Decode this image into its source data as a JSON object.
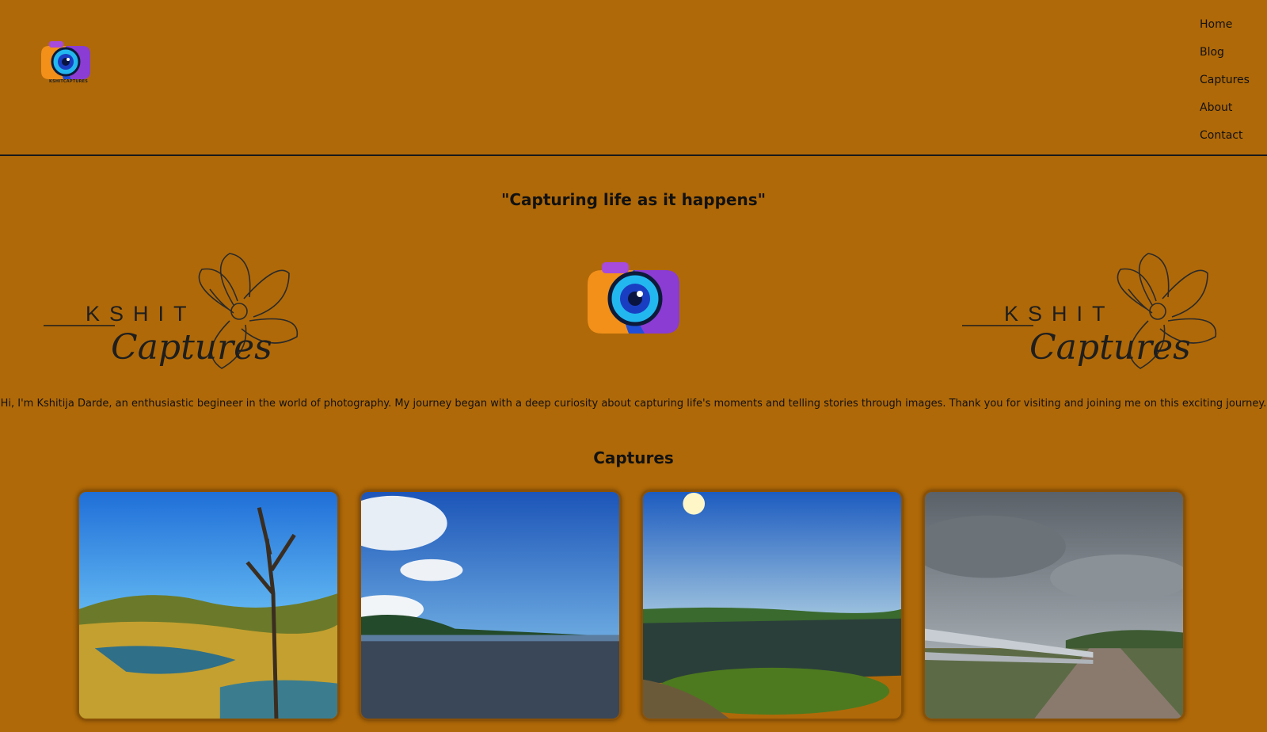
{
  "theme": {
    "background": "#b06908",
    "text": "#111111",
    "accent": "#1e1e1e"
  },
  "header": {
    "logo_text": "KSHITCAPTURES",
    "logo_icon": "camera-icon",
    "nav": [
      "Home",
      "Blog",
      "Captures",
      "About",
      "Contact"
    ]
  },
  "hero": {
    "tagline": "\"Capturing life as it happens\"",
    "brand_left": {
      "line1": "KSHIT",
      "line2": "Captures"
    },
    "brand_right": {
      "line1": "KSHIT",
      "line2": "Captures"
    },
    "center_icon": "camera-icon",
    "intro": "Hi, I'm Kshitija Darde, an enthusiastic begineer in the world of photography. My journey began with a deep curiosity about capturing life's moments and telling stories through images. Thank you for visiting and joining me on this exciting journey."
  },
  "captures": {
    "title": "Captures",
    "photos": [
      {
        "name": "river-tree-photo"
      },
      {
        "name": "beach-photo"
      },
      {
        "name": "lake-cliff-photo"
      },
      {
        "name": "road-bridge-photo"
      }
    ]
  }
}
